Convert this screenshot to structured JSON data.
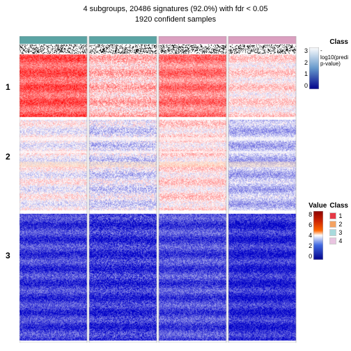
{
  "title": {
    "line1": "4 subgroups, 20486 signatures (92.0%) with fdr < 0.05",
    "line2": "1920 confident samples"
  },
  "legend": {
    "top_title": "Class",
    "pval_label": "-log10(predi",
    "pval_label2": "p-value)",
    "pval_ticks": [
      "3",
      "2",
      "1",
      "0"
    ],
    "bottom_title_value": "Value",
    "bottom_title_class": "Class",
    "value_ticks": [
      "8",
      "6",
      "4",
      "2",
      "0"
    ],
    "class_items": [
      {
        "label": "1",
        "color": "#e63946"
      },
      {
        "label": "2",
        "color": "#f4a261"
      },
      {
        "label": "3",
        "color": "#a8dadc"
      },
      {
        "label": "4",
        "color": "#e9c4e0"
      }
    ]
  },
  "row_labels": [
    "1",
    "2",
    "3"
  ],
  "class_colors": {
    "1": "#5ba4a4",
    "2": "#5ba4a4",
    "3": "#dba0c0",
    "4": "#dba0c0"
  }
}
